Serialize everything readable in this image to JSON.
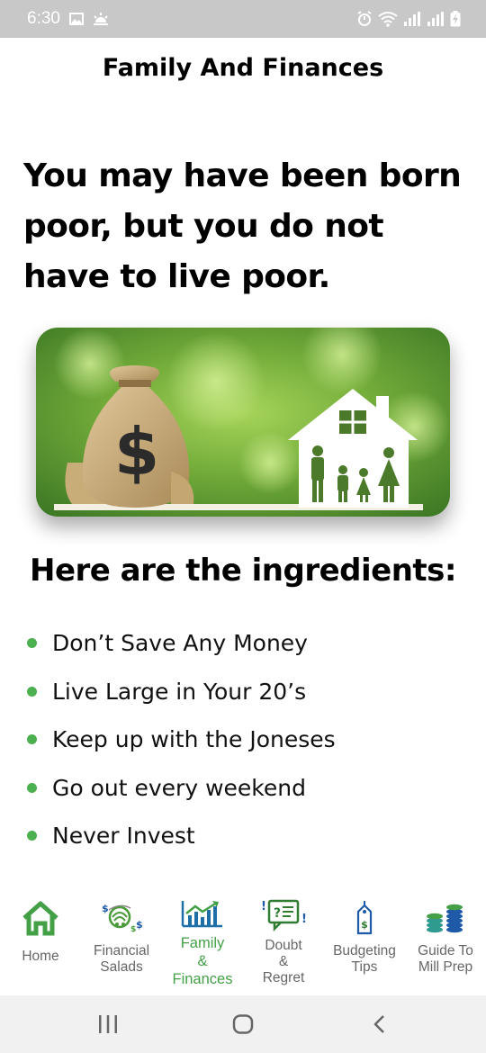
{
  "status_bar": {
    "time": "6:30"
  },
  "header": {
    "title": "Family And Finances"
  },
  "quote": "You may have been born poor, but you do not have to live poor.",
  "hero_image": {
    "description_icon": "money-bag-and-family-house-image"
  },
  "ingredients": {
    "heading": "Here are the ingredients:",
    "items": [
      "Don’t Save Any Money",
      "Live Large in Your 20’s",
      "Keep up with the Joneses",
      "Go out every weekend",
      "Never Invest"
    ]
  },
  "bottom_nav": {
    "items": [
      {
        "label": "Home",
        "icon": "house-icon"
      },
      {
        "label": "Financial\nSalads",
        "icon": "salad-money-icon"
      },
      {
        "label": "Family\n&\nFinances",
        "icon": "bar-chart-growth-icon",
        "active": true
      },
      {
        "label": "Doubt\n&\nRegret",
        "icon": "question-bubble-icon"
      },
      {
        "label": "Budgeting\nTips",
        "icon": "price-tag-icon"
      },
      {
        "label": "Guide To\nMill Prep",
        "icon": "coin-stacks-icon"
      }
    ]
  },
  "colors": {
    "accent": "#43a047",
    "bullet": "#4caf50",
    "status_bar_bg": "#c8c8c8",
    "nav_label": "#666666"
  }
}
